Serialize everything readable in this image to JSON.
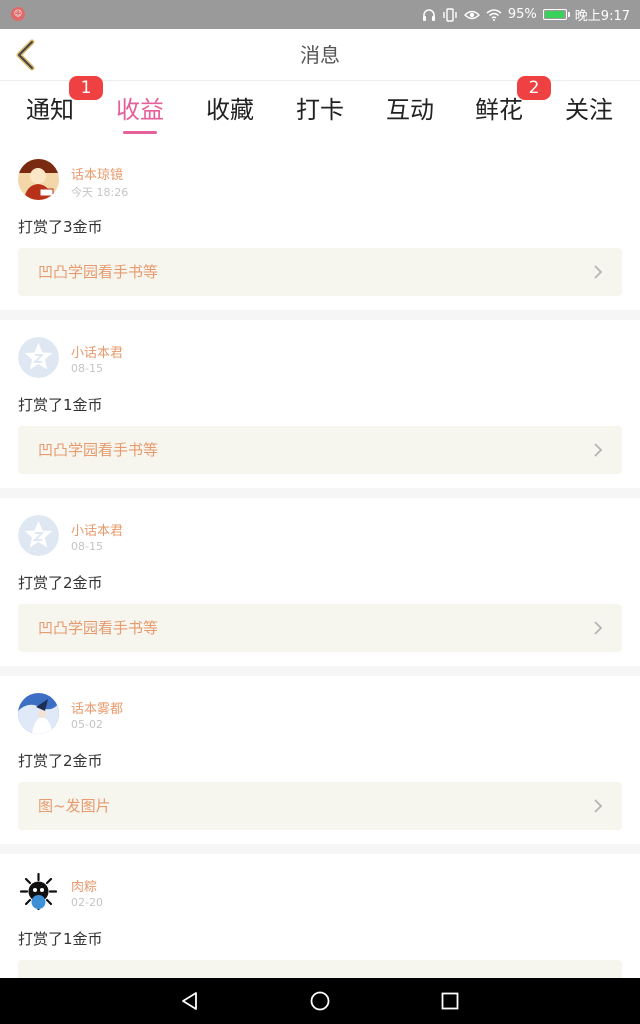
{
  "status_bar": {
    "battery_percent": "95%",
    "battery_level": 0.95,
    "time": "晚上9:17",
    "colors": {
      "background": "#9a9a9a",
      "battery_fill": "#3ad15a"
    }
  },
  "header": {
    "title": "消息",
    "back_icon": "chevron-left-icon"
  },
  "tabs": [
    {
      "label": "通知",
      "badge": "1",
      "active": false
    },
    {
      "label": "收益",
      "badge": "",
      "active": true
    },
    {
      "label": "收藏",
      "badge": "",
      "active": false
    },
    {
      "label": "打卡",
      "badge": "",
      "active": false
    },
    {
      "label": "互动",
      "badge": "",
      "active": false
    },
    {
      "label": "鲜花",
      "badge": "2",
      "active": false
    },
    {
      "label": "关注",
      "badge": "",
      "active": false
    }
  ],
  "feed": {
    "items": [
      {
        "user": "话本琼镜",
        "time": "今天 18:26",
        "action": "打赏了3金币",
        "ref_title": "凹凸学园看手书等",
        "avatar": "drawn-avatar-icon"
      },
      {
        "user": "小话本君",
        "time": "08-15",
        "action": "打赏了1金币",
        "ref_title": "凹凸学园看手书等",
        "avatar": "star-avatar-icon"
      },
      {
        "user": "小话本君",
        "time": "08-15",
        "action": "打赏了2金币",
        "ref_title": "凹凸学园看手书等",
        "avatar": "star-avatar-icon"
      },
      {
        "user": "话本雾都",
        "time": "05-02",
        "action": "打赏了2金币",
        "ref_title": "图~发图片",
        "avatar": "anime-avatar-icon"
      },
      {
        "user": "肉粽",
        "time": "02-20",
        "action": "打赏了1金币",
        "ref_title": "",
        "avatar": "virus-avatar-icon"
      }
    ]
  },
  "nav_bar": {
    "back_icon": "triangle-back-icon",
    "home_icon": "circle-home-icon",
    "recents_icon": "square-recents-icon"
  },
  "colors": {
    "accent": "#e5609a",
    "badge": "#f04142",
    "name_color": "#e79a6d",
    "ref_bg": "#f6f5ee"
  }
}
